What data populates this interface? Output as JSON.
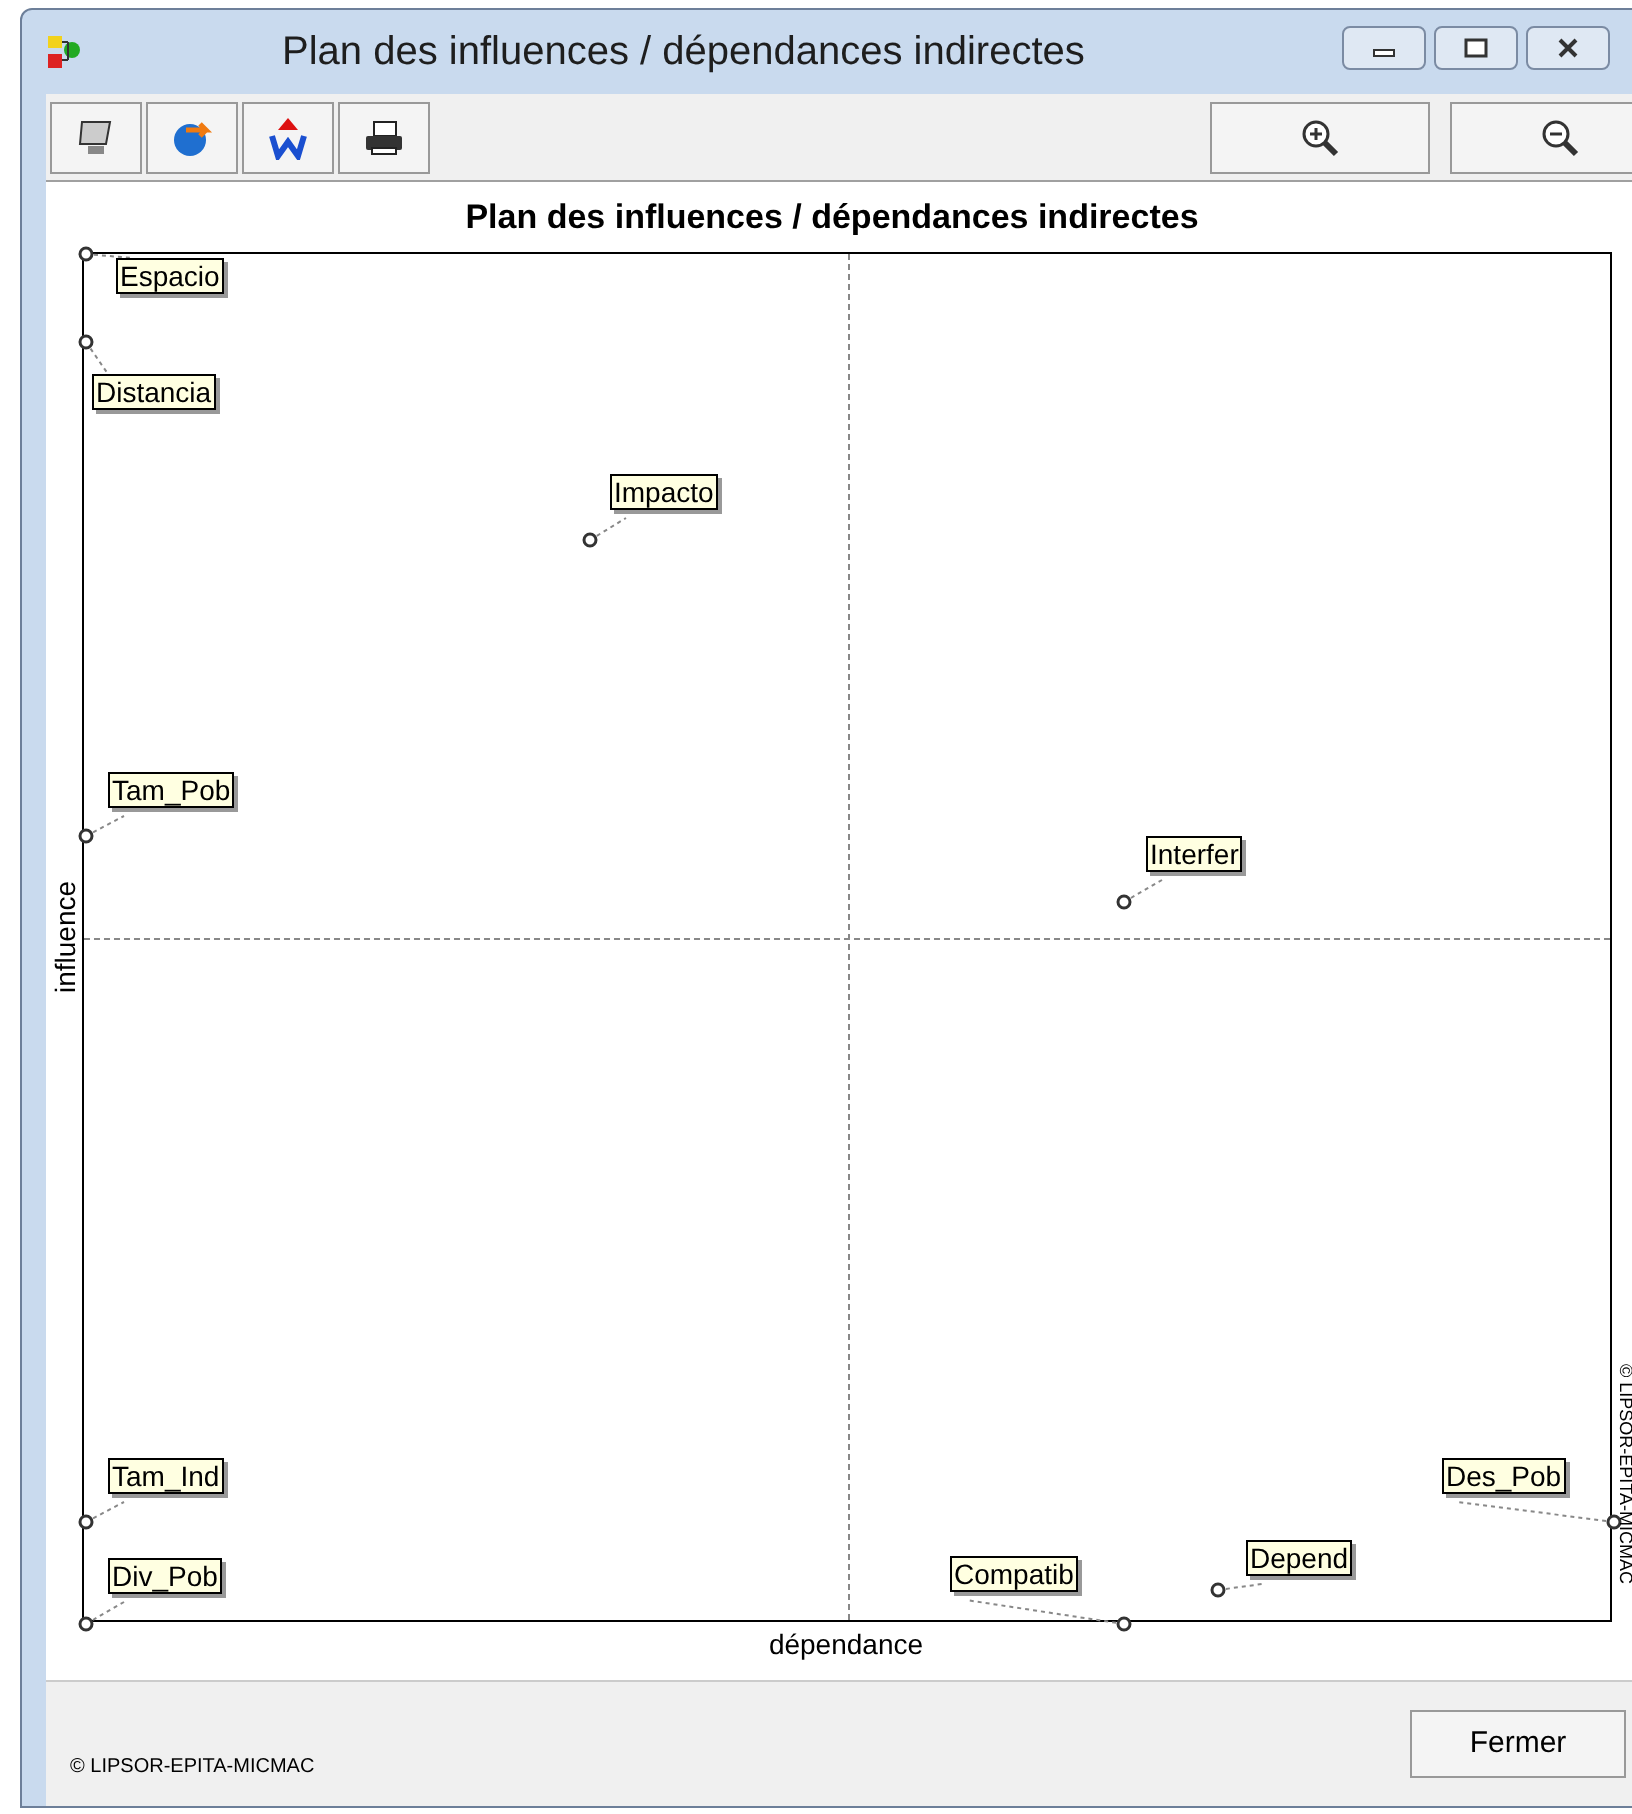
{
  "window": {
    "title": "Plan des influences / dépendances indirectes"
  },
  "chart": {
    "title": "Plan des influences / dépendances indirectes",
    "xlabel": "dépendance",
    "ylabel": "influence",
    "watermark": "© LIPSOR-EPITA-MICMAC",
    "points": [
      {
        "label": "Espacio"
      },
      {
        "label": "Distancia"
      },
      {
        "label": "Impacto"
      },
      {
        "label": "Tam_Pob"
      },
      {
        "label": "Interfer"
      },
      {
        "label": "Tam_Ind"
      },
      {
        "label": "Div_Pob"
      },
      {
        "label": "Compatib"
      },
      {
        "label": "Depend"
      },
      {
        "label": "Des_Pob"
      }
    ]
  },
  "footer": {
    "copyright": "© LIPSOR-EPITA-MICMAC",
    "close_button": "Fermer"
  }
}
